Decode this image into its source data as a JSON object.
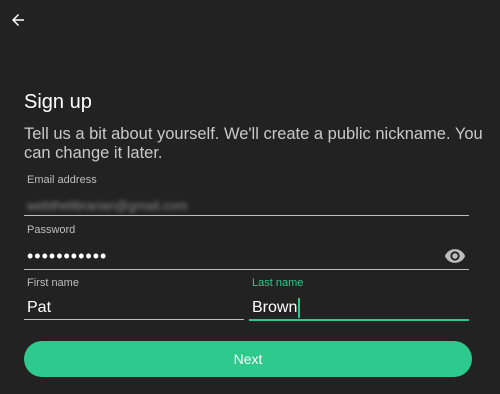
{
  "header": {
    "back_icon": "arrow-left-icon"
  },
  "title": "Sign up",
  "subtitle": "Tell us a bit about yourself. We'll create a public nickname. You can change it later.",
  "form": {
    "email": {
      "label": "Email address",
      "value": "webthelibrarian@gmail.com"
    },
    "password": {
      "label": "Password",
      "value": "•••••••••••",
      "toggle_icon": "eye-icon"
    },
    "first_name": {
      "label": "First name",
      "value": "Pat"
    },
    "last_name": {
      "label": "Last name",
      "value": "Brown"
    }
  },
  "next_button": {
    "label": "Next"
  },
  "colors": {
    "background": "#222222",
    "accent": "#2ec98c",
    "text": "#ffffff",
    "muted": "#bdbdbd"
  }
}
